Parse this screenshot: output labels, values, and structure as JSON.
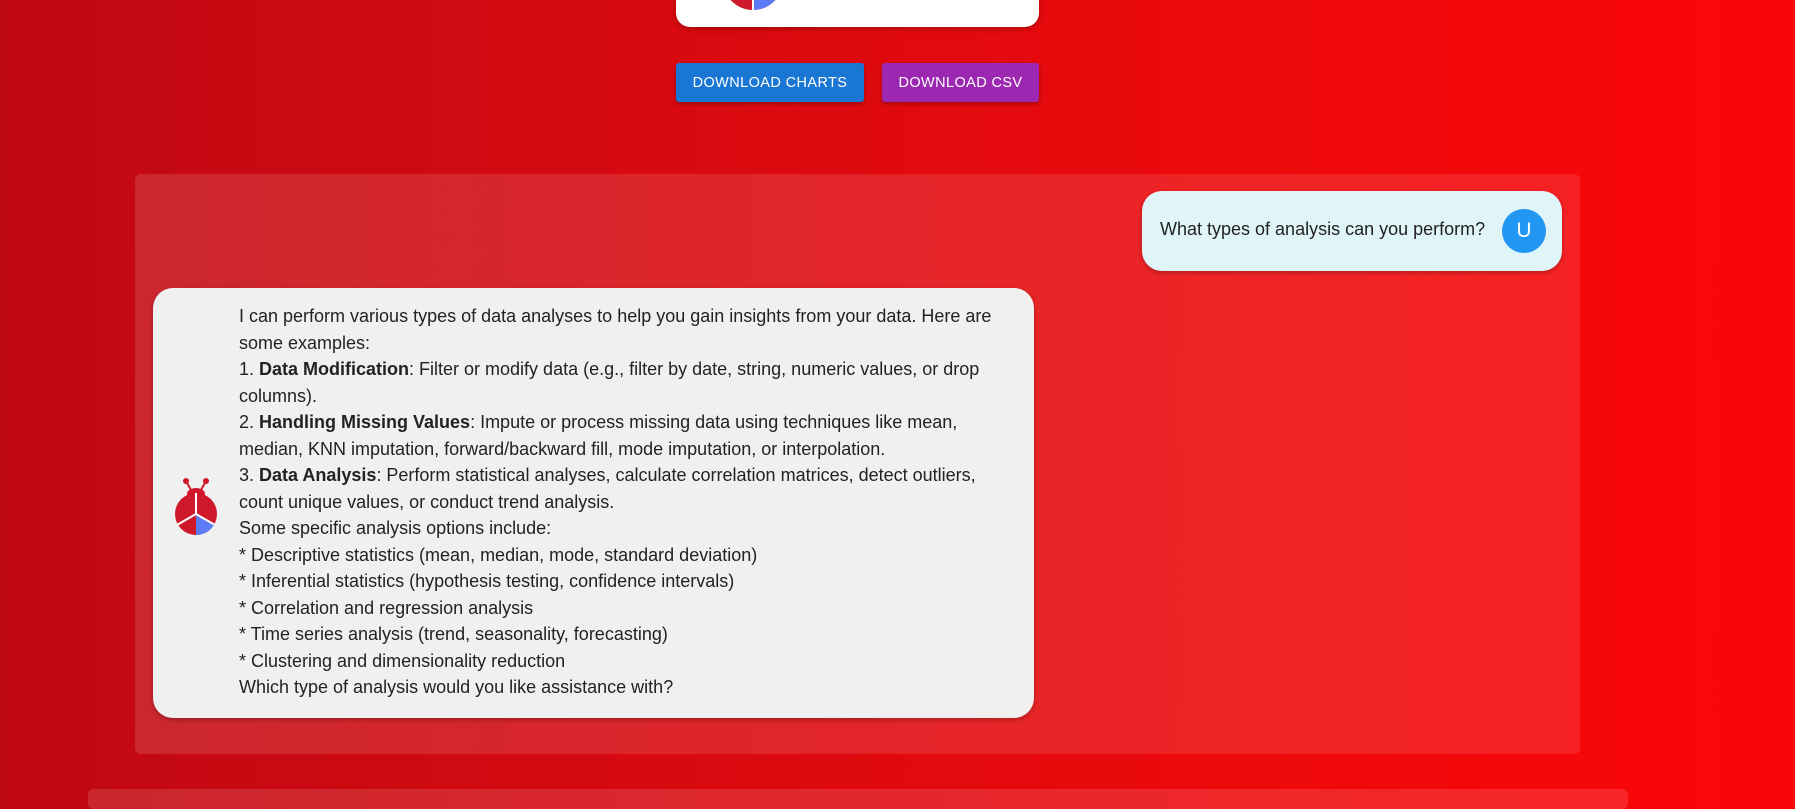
{
  "buttons": {
    "download_charts": "DOWNLOAD CHARTS",
    "download_csv": "DOWNLOAD CSV"
  },
  "user_message": {
    "text": "What types of analysis can you perform?",
    "avatar_letter": "U"
  },
  "bot_message": {
    "intro": "I can perform various types of data analyses to help you gain insights from your data. Here are some examples:",
    "items": [
      {
        "number": "1. ",
        "title": "Data Modification",
        "text": ": Filter or modify data (e.g., filter by date, string, numeric values, or drop columns)."
      },
      {
        "number": "2. ",
        "title": "Handling Missing Values",
        "text": ": Impute or process missing data using techniques like mean, median, KNN imputation, forward/backward fill, mode imputation, or interpolation."
      },
      {
        "number": "3. ",
        "title": "Data Analysis",
        "text": ": Perform statistical analyses, calculate correlation matrices, detect outliers, count unique values, or conduct trend analysis."
      }
    ],
    "options_heading": "Some specific analysis options include:",
    "options": [
      "* Descriptive statistics (mean, median, mode, standard deviation)",
      "* Inferential statistics (hypothesis testing, confidence intervals)",
      "* Correlation and regression analysis",
      "* Time series analysis (trend, seasonality, forecasting)",
      "* Clustering and dimensionality reduction"
    ],
    "closing": "Which type of analysis would you like assistance with?"
  },
  "icons": {
    "bot_avatar": "ladybug-logo-icon",
    "chart_glimpse": "pie-chart-icon"
  },
  "colors": {
    "background_start": "#bf0913",
    "background_end": "#fb0608",
    "download_charts": "#1976d2",
    "download_csv": "#9c27b0",
    "user_bubble": "#e0f5f7",
    "user_avatar": "#2196f3",
    "bot_bubble": "#f0f0f0",
    "logo_red": "#d0182b",
    "logo_blue": "#5b7cf5"
  }
}
